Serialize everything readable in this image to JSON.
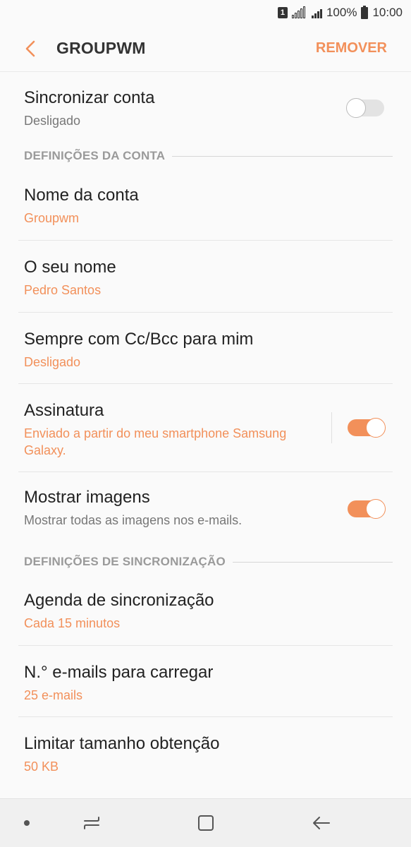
{
  "status_bar": {
    "sim_label": "1",
    "battery_percent": "100%",
    "time": "10:00"
  },
  "header": {
    "title": "GROUPWM",
    "action_label": "REMOVER",
    "back_icon": "chevron-left-icon"
  },
  "sync_account": {
    "title": "Sincronizar conta",
    "subtitle": "Desligado",
    "enabled": false
  },
  "account_settings": {
    "section_title": "DEFINIÇÕES DA CONTA",
    "account_name": {
      "title": "Nome da conta",
      "value": "Groupwm"
    },
    "your_name": {
      "title": "O seu nome",
      "value": "Pedro Santos"
    },
    "always_cc_bcc": {
      "title": "Sempre com Cc/Bcc para mim",
      "value": "Desligado"
    },
    "signature": {
      "title": "Assinatura",
      "value": "Enviado a partir do meu smartphone Samsung Galaxy.",
      "enabled": true
    },
    "show_images": {
      "title": "Mostrar imagens",
      "subtitle": "Mostrar todas as imagens nos e-mails.",
      "enabled": true
    }
  },
  "sync_settings": {
    "section_title": "DEFINIÇÕES DE SINCRONIZAÇÃO",
    "sync_schedule": {
      "title": "Agenda de sincronização",
      "value": "Cada 15 minutos"
    },
    "emails_to_load": {
      "title": "N.° e-mails para carregar",
      "value": "25 e-mails"
    },
    "limit_retrieval_size": {
      "title": "Limitar tamanho obtenção",
      "value": "50 KB"
    }
  },
  "nav_bar": {
    "items": [
      "dot-icon",
      "recent-apps-icon",
      "home-icon",
      "back-arrow-icon"
    ]
  },
  "colors": {
    "accent": "#f2905a",
    "background": "#fafafa",
    "nav_background": "#f0f0f0"
  }
}
